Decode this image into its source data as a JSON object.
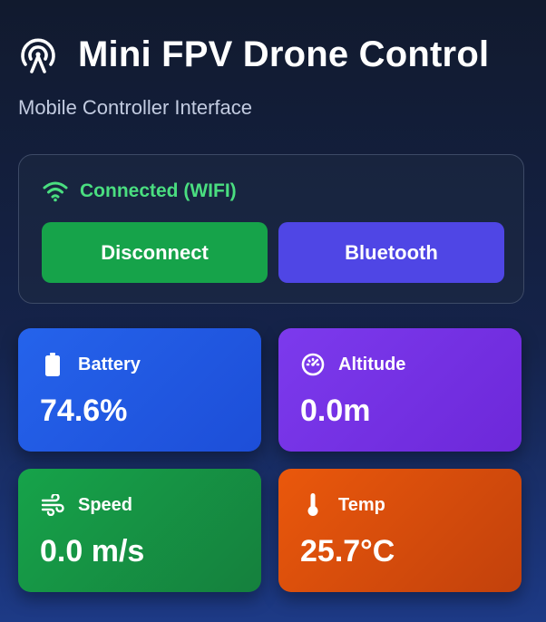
{
  "app": {
    "title": "Mini FPV Drone Control",
    "subtitle": "Mobile Controller Interface",
    "logo_icon": "antenna-broadcast-icon"
  },
  "connection": {
    "status_text": "Connected (WIFI)",
    "status_color": "#4ade80",
    "status_icon": "wifi-icon",
    "disconnect_label": "Disconnect",
    "disconnect_color": "#16a34a",
    "bluetooth_label": "Bluetooth",
    "bluetooth_color": "#4f46e5"
  },
  "telemetry": [
    {
      "label": "Battery",
      "value": "74.6%",
      "icon": "battery-icon",
      "color": "#2563eb"
    },
    {
      "label": "Altitude",
      "value": "0.0m",
      "icon": "gauge-icon",
      "color": "#7c3aed"
    },
    {
      "label": "Speed",
      "value": "0.0 m/s",
      "icon": "wind-icon",
      "color": "#16a34a"
    },
    {
      "label": "Temp",
      "value": "25.7°C",
      "icon": "thermometer-icon",
      "color": "#ea580c"
    }
  ]
}
